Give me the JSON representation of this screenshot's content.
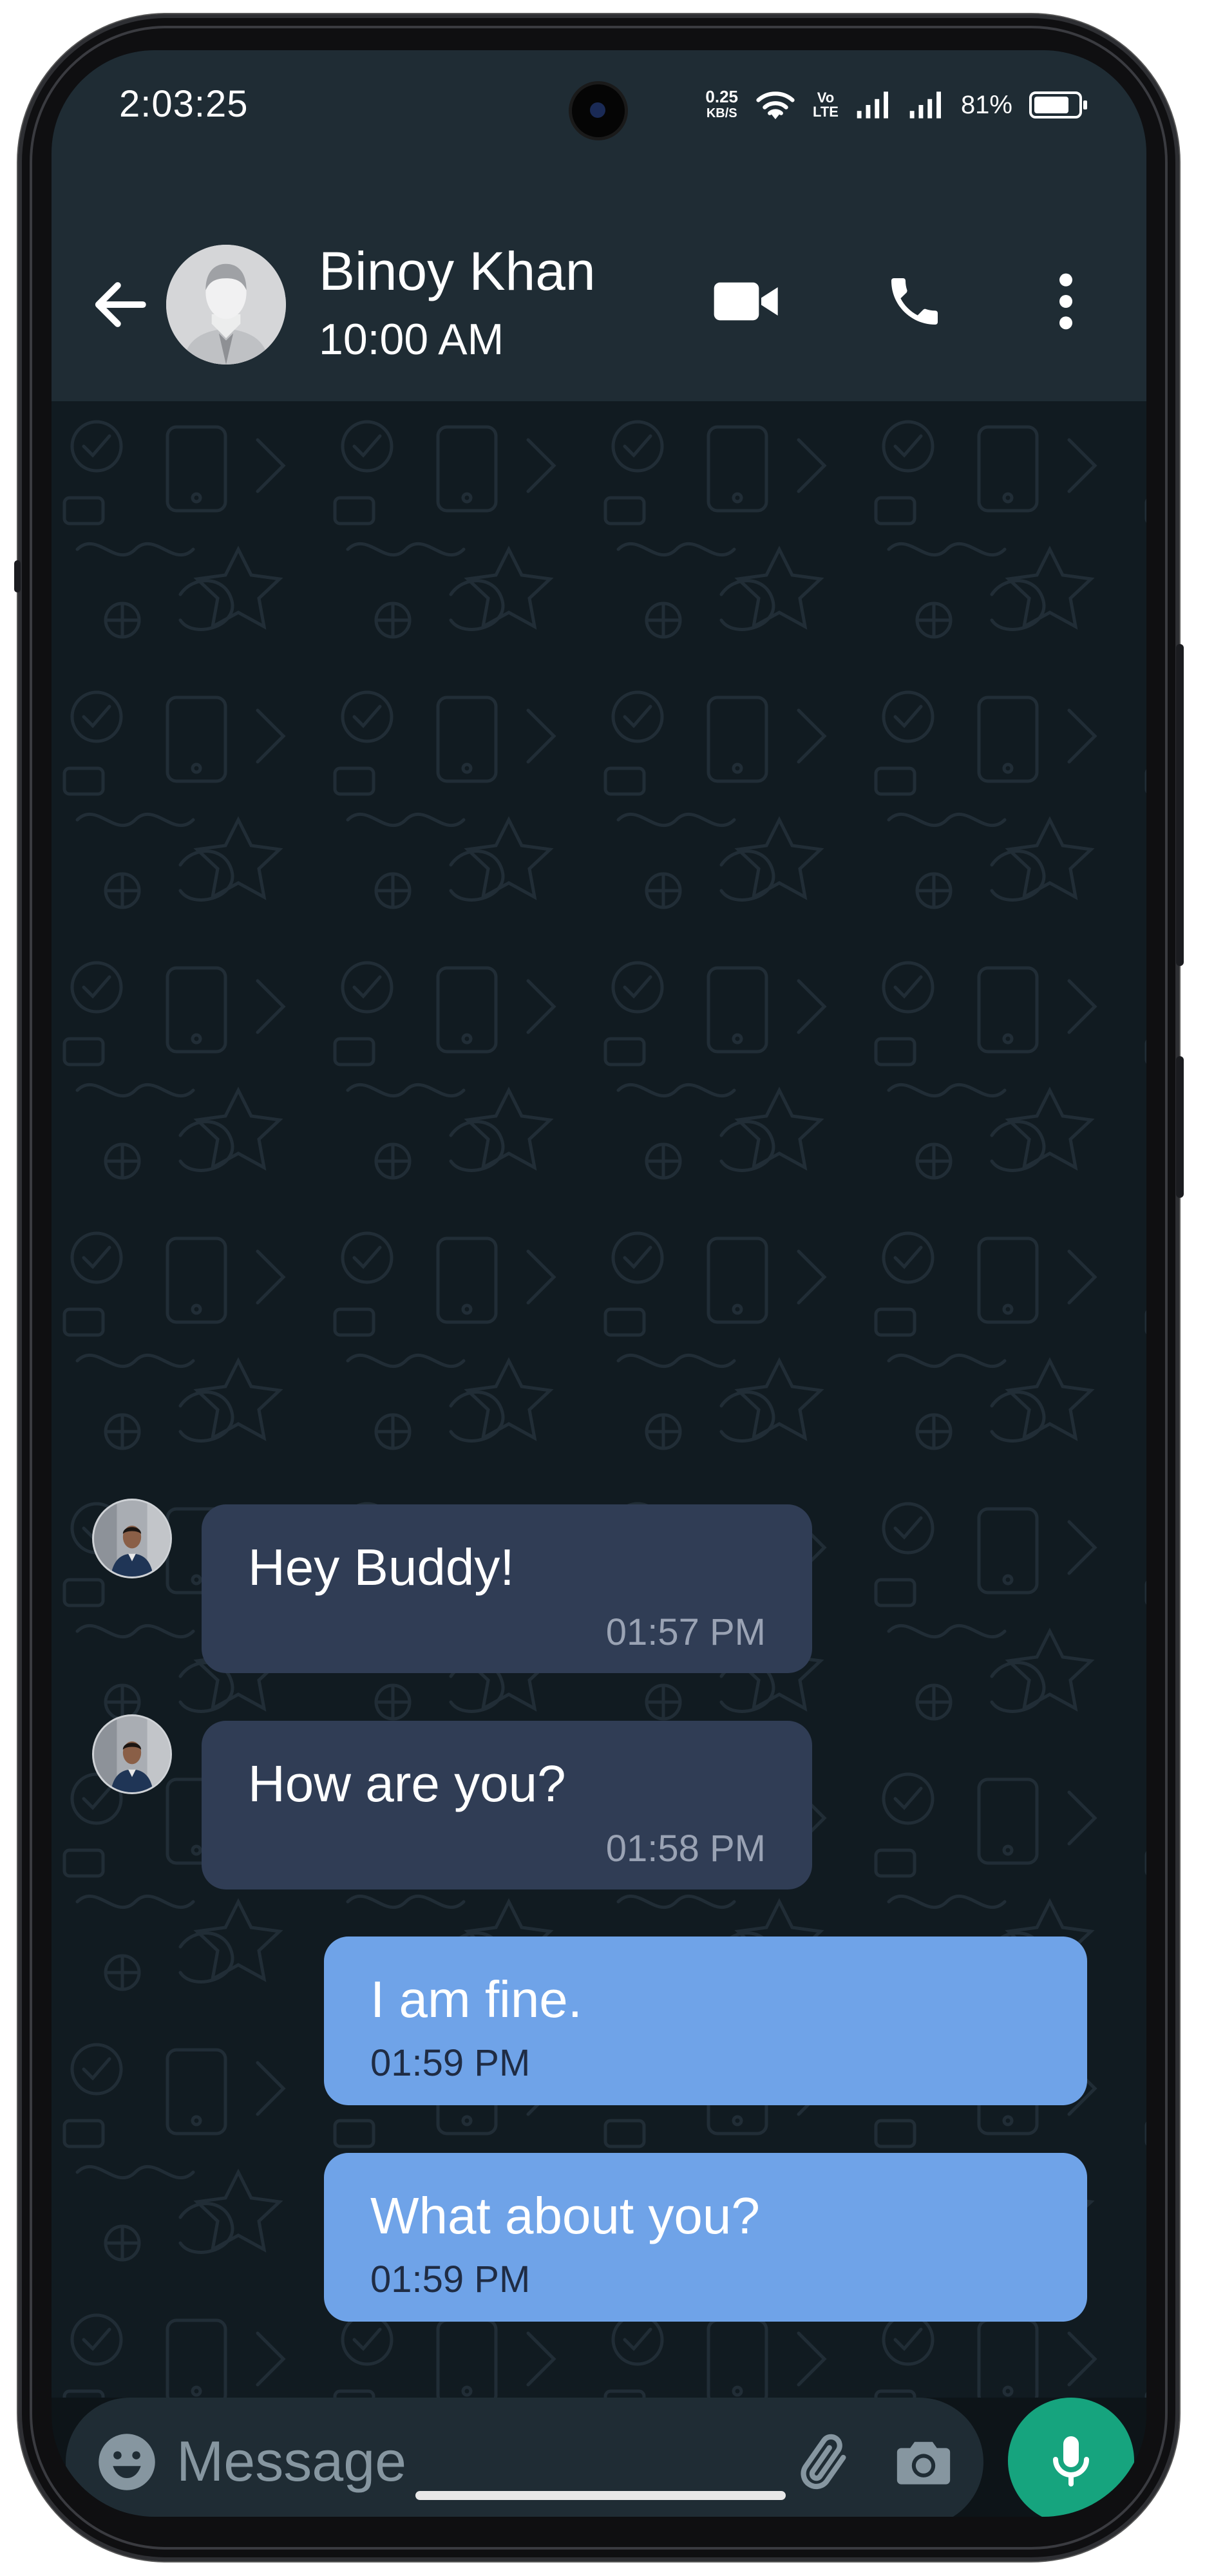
{
  "status_bar": {
    "time": "2:03:25",
    "net_speed_value": "0.25",
    "net_speed_unit": "KB/S",
    "volte_top": "Vo",
    "volte_bottom": "LTE",
    "battery_percent": "81%",
    "battery_level": 0.81,
    "icons": [
      "wifi-icon",
      "volte-icon",
      "signal-icon",
      "signal-icon",
      "battery-icon"
    ]
  },
  "header": {
    "contact_name": "Binoy Khan",
    "contact_status": "10:00 AM",
    "icons": [
      "back-arrow-icon",
      "video-call-icon",
      "voice-call-icon",
      "more-vert-icon"
    ]
  },
  "messages": [
    {
      "direction": "incoming",
      "text": "Hey Buddy!",
      "time": "01:57 PM"
    },
    {
      "direction": "incoming",
      "text": "How are you?",
      "time": "01:58 PM"
    },
    {
      "direction": "outgoing",
      "text": "I am fine.",
      "time": "01:59 PM"
    },
    {
      "direction": "outgoing",
      "text": "What about you?",
      "time": "01:59 PM"
    }
  ],
  "composer": {
    "placeholder": "Message",
    "icons": [
      "emoji-icon",
      "attach-icon",
      "camera-icon",
      "mic-icon"
    ]
  },
  "colors": {
    "header_bg": "#1f2c34",
    "chat_bg": "#111b21",
    "incoming_bubble": "#303d55",
    "outgoing_bubble": "#6fa3e8",
    "mic_button": "#16a47e"
  }
}
